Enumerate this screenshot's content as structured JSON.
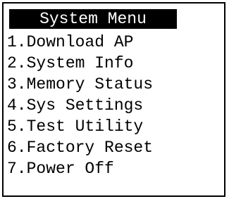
{
  "menu": {
    "title": "System Menu",
    "items": [
      {
        "label": "1.Download AP"
      },
      {
        "label": "2.System Info"
      },
      {
        "label": "3.Memory Status"
      },
      {
        "label": "4.Sys Settings"
      },
      {
        "label": "5.Test Utility"
      },
      {
        "label": "6.Factory Reset"
      },
      {
        "label": "7.Power Off"
      }
    ]
  }
}
